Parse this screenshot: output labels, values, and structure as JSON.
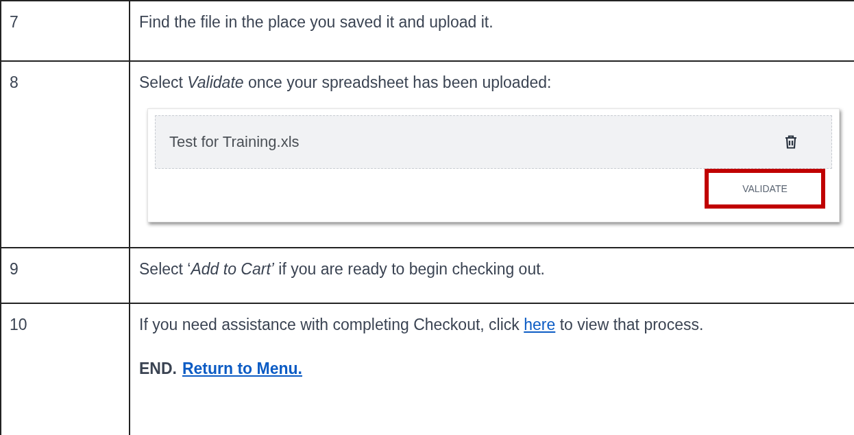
{
  "rows": [
    {
      "step": "7",
      "kind": "text",
      "text": "Find the file in the place you saved it and upload it."
    },
    {
      "step": "8",
      "kind": "screenshot",
      "text": "Select *Validate* once your spreadsheet has been uploaded:",
      "file": {
        "name": "Test for Training.xls"
      },
      "button": {
        "label": "VALIDATE",
        "highlighted": true
      }
    },
    {
      "step": "9",
      "kind": "text",
      "text": "Select ‘*Add to Cart’* if you are ready to begin checking out."
    },
    {
      "step": "10",
      "kind": "links",
      "text_before": "If you need assistance with completing Checkout, click ",
      "link": "here",
      "text_after": " to view that process.",
      "end_label": "END.",
      "end_link": "Return to Menu."
    }
  ]
}
